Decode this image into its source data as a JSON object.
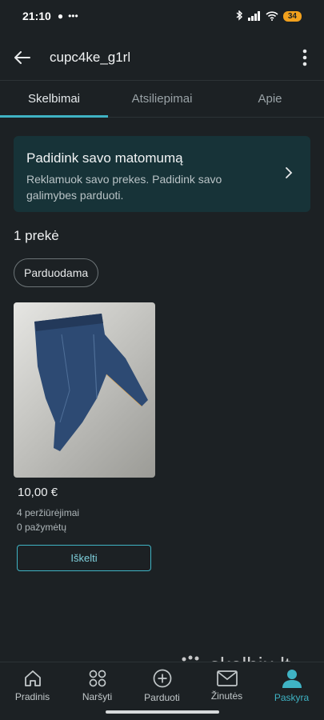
{
  "status": {
    "time": "21:10",
    "battery": "34"
  },
  "header": {
    "title": "cupc4ke_g1rl"
  },
  "tabs": [
    {
      "label": "Skelbimai",
      "active": true
    },
    {
      "label": "Atsiliepimai",
      "active": false
    },
    {
      "label": "Apie",
      "active": false
    }
  ],
  "promo": {
    "title": "Padidink savo matomumą",
    "text": "Reklamuok savo prekes. Padidink savo galimybes parduoti."
  },
  "listings": {
    "count_label": "1 prekė",
    "filter_chip": "Parduodama",
    "items": [
      {
        "price": "10,00 €",
        "views": "4 peržiūrėjimai",
        "likes": "0 pažymėtų",
        "action_label": "Iškelti"
      }
    ]
  },
  "watermark": {
    "text": "skelbiu.lt"
  },
  "bottom_nav": [
    {
      "label": "Pradinis",
      "icon": "home-icon",
      "active": false
    },
    {
      "label": "Naršyti",
      "icon": "grid-icon",
      "active": false
    },
    {
      "label": "Parduoti",
      "icon": "plus-circle-icon",
      "active": false
    },
    {
      "label": "Žinutės",
      "icon": "mail-icon",
      "active": false
    },
    {
      "label": "Paskyra",
      "icon": "person-icon",
      "active": true
    }
  ],
  "colors": {
    "background": "#1c2124",
    "accent": "#3fb3c4",
    "promo_bg": "#173338"
  }
}
